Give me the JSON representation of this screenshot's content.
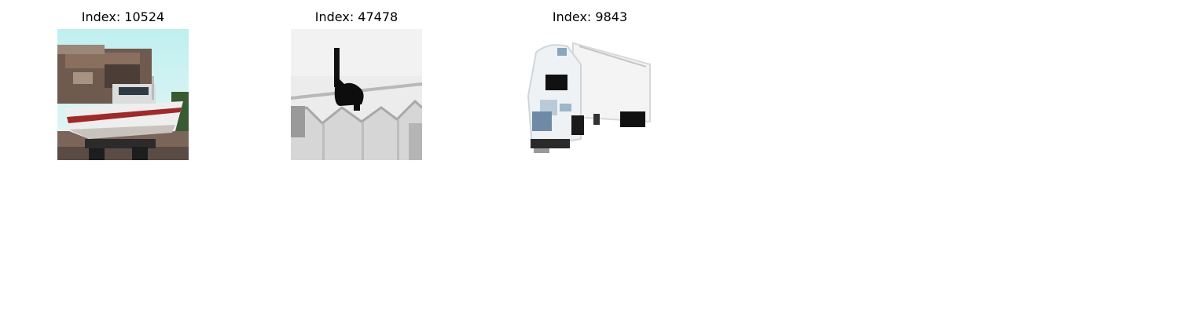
{
  "panels": [
    {
      "title": "Index: 10524"
    },
    {
      "title": "Index: 47478"
    },
    {
      "title": "Index: 9843"
    }
  ]
}
